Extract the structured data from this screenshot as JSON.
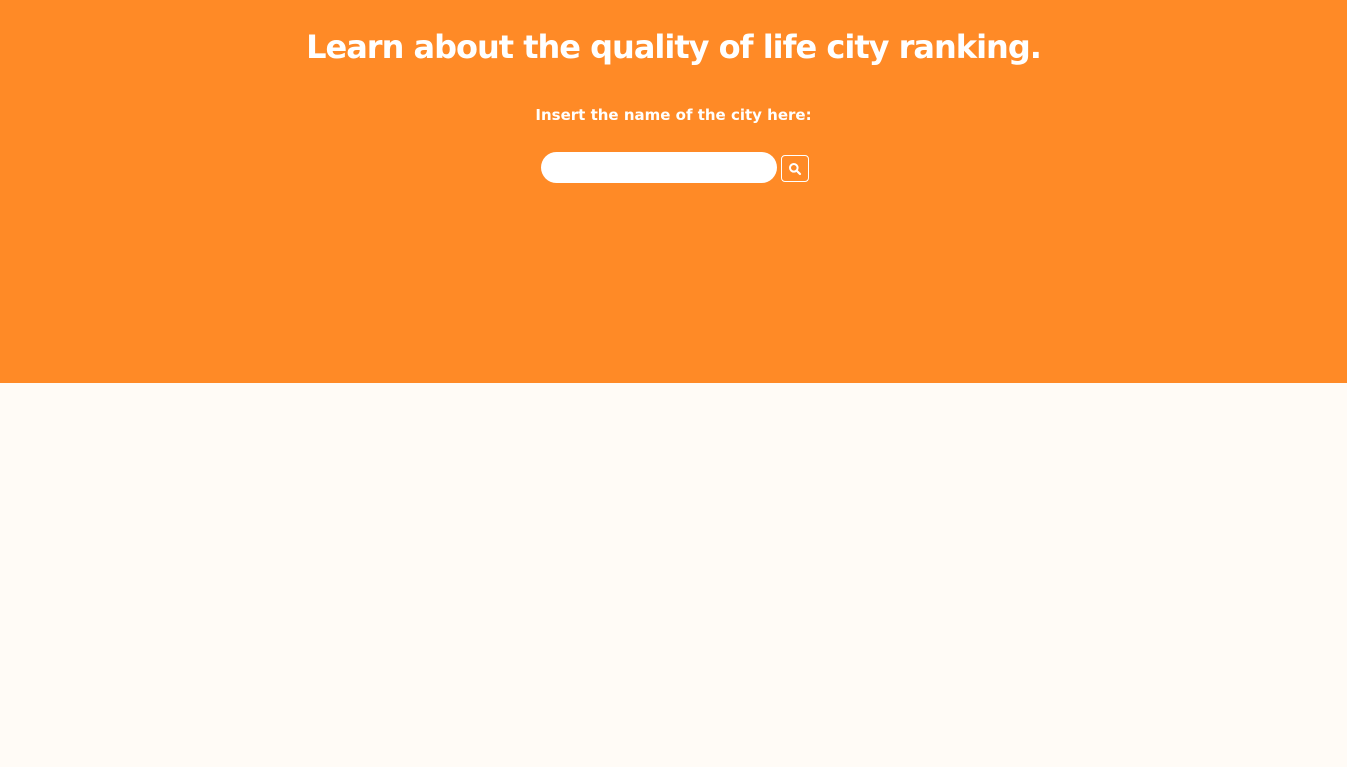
{
  "page": {
    "title": "Learn about the quality of life city ranking.",
    "prompt": "Insert the name of the city here:"
  },
  "search": {
    "value": "",
    "placeholder": "",
    "button_icon": "search-icon"
  },
  "colors": {
    "hero_background": "#ff8a26",
    "page_background": "#fffbf6",
    "text": "#ffffff"
  }
}
